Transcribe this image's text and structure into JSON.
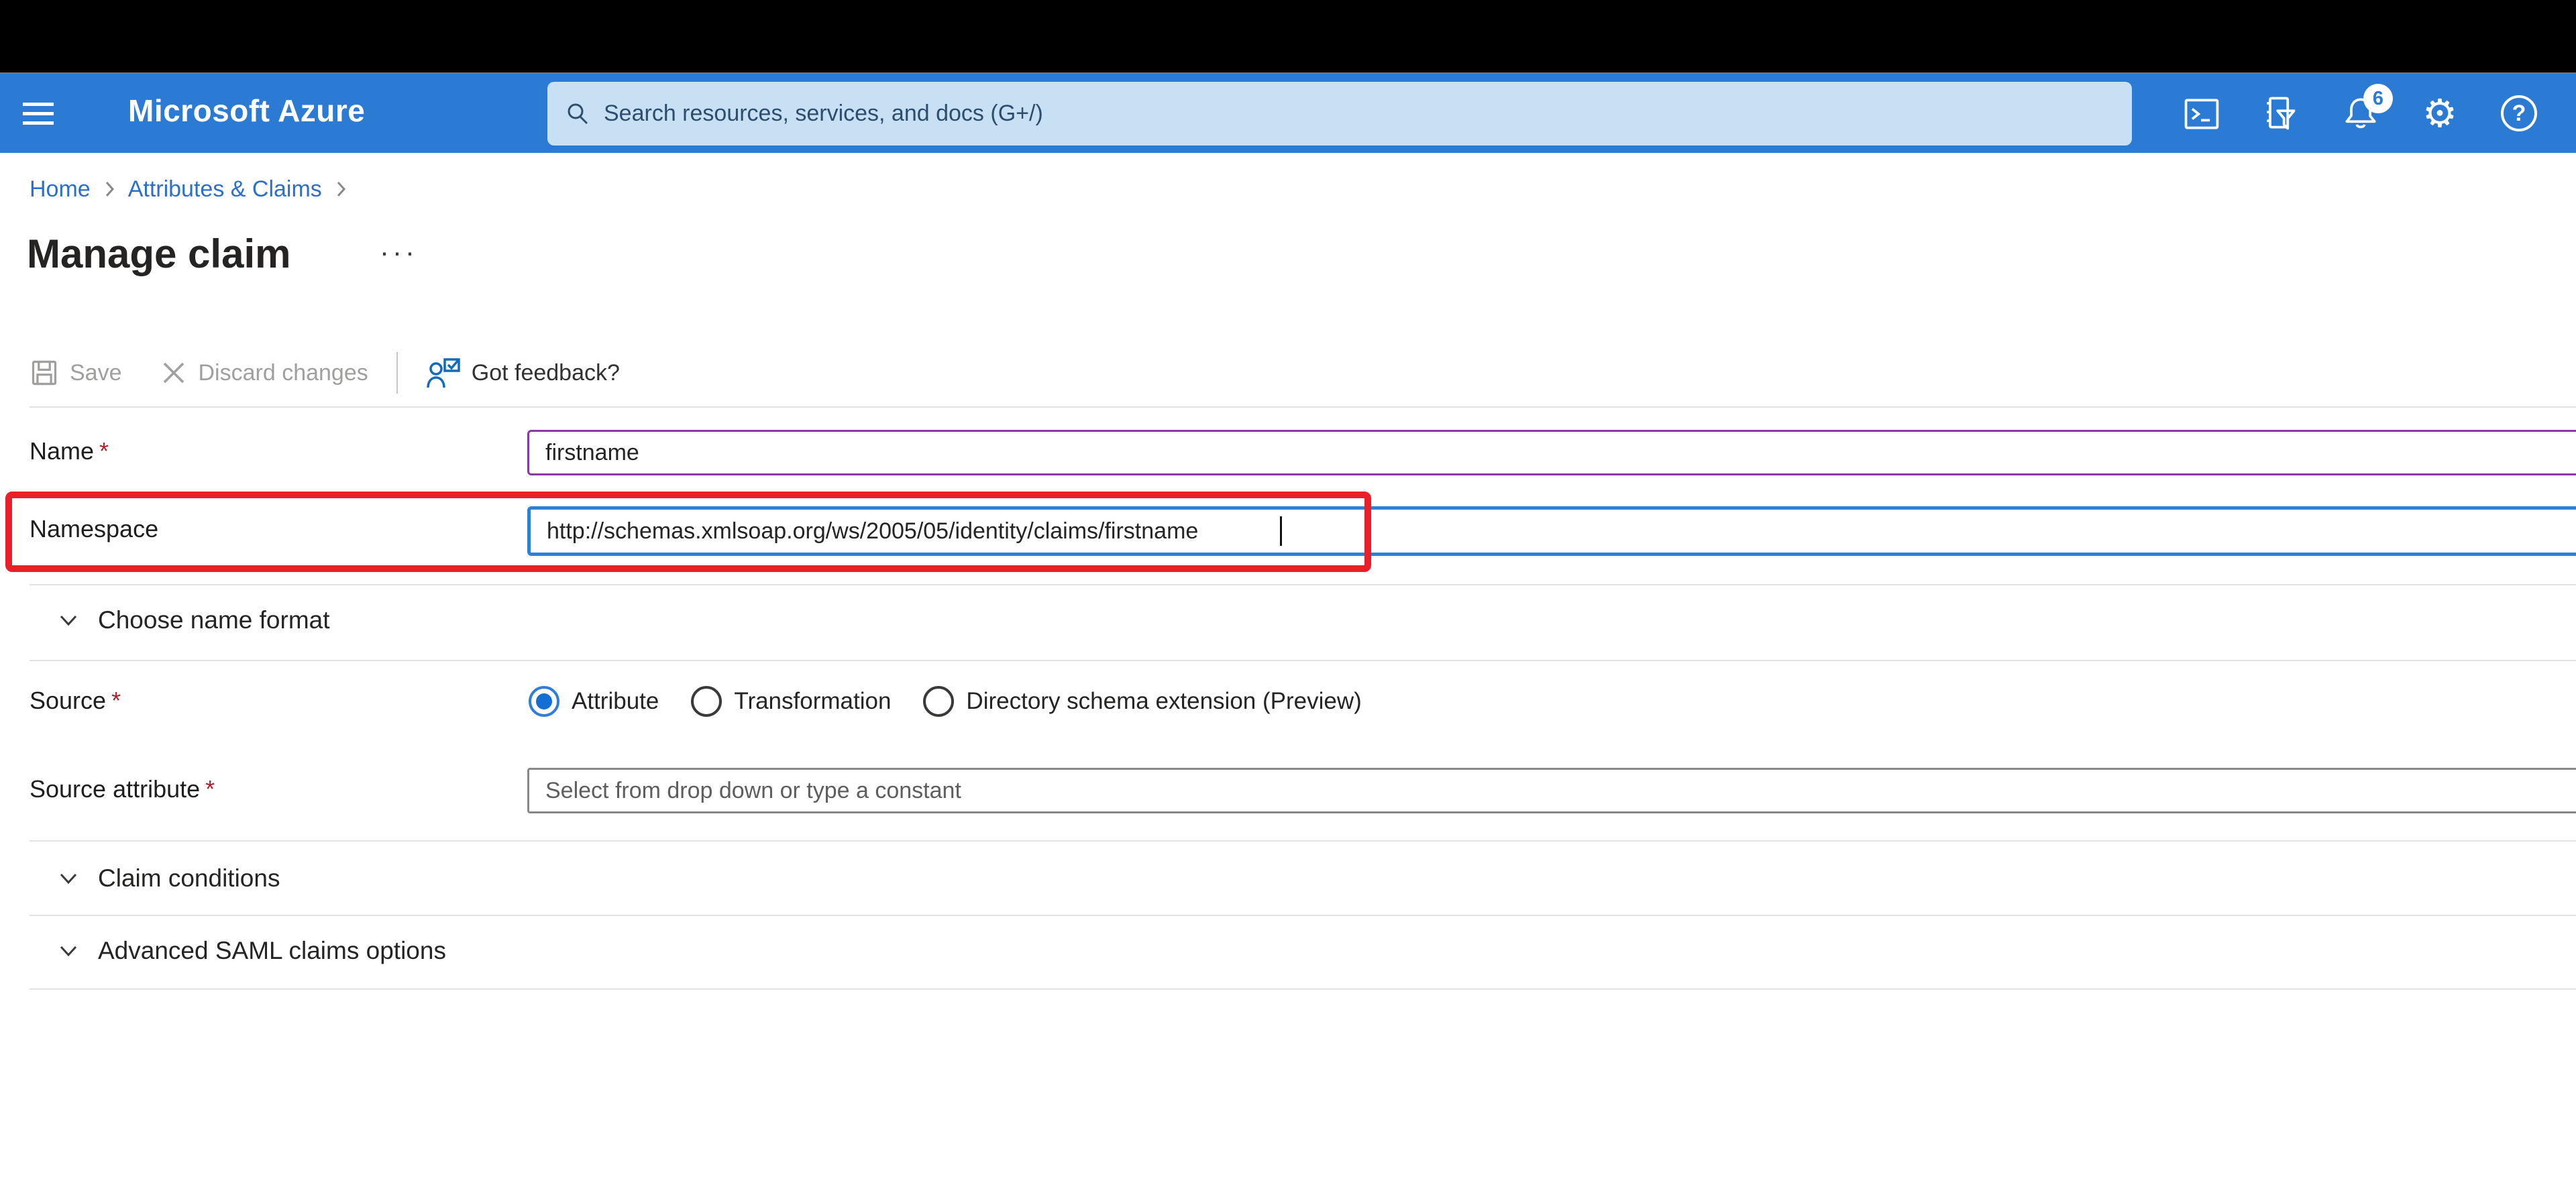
{
  "topbar": {
    "brand": "Microsoft Azure",
    "search_placeholder": "Search resources, services, and docs (G+/)",
    "notification_count": "6",
    "help_glyph": "?",
    "gear_glyph": "⚙"
  },
  "breadcrumb": {
    "home": "Home",
    "claims": "Attributes & Claims"
  },
  "page": {
    "title": "Manage claim",
    "more_label": "···"
  },
  "toolbar": {
    "save_label": "Save",
    "discard_label": "Discard changes",
    "feedback_label": "Got feedback?"
  },
  "form": {
    "name": {
      "label": "Name",
      "required": "*",
      "value": "firstname"
    },
    "namespace": {
      "label": "Namespace",
      "value": "http://schemas.xmlsoap.org/ws/2005/05/identity/claims/firstname"
    },
    "choose_name_format": {
      "label": "Choose name format"
    },
    "source": {
      "label": "Source",
      "required": "*",
      "options": [
        {
          "label": "Attribute",
          "selected": true
        },
        {
          "label": "Transformation",
          "selected": false
        },
        {
          "label": "Directory schema extension (Preview)",
          "selected": false
        }
      ]
    },
    "source_attribute": {
      "label": "Source attribute",
      "required": "*",
      "placeholder": "Select from drop down or type a constant"
    },
    "claim_conditions": {
      "label": "Claim conditions"
    },
    "advanced_saml": {
      "label": "Advanced SAML claims options"
    }
  },
  "colors": {
    "topbar_blue": "#2b7ad4",
    "search_bg": "#c7e0f4",
    "link_blue": "#2a6fd0",
    "focus_border_blue": "#2e81d8",
    "modified_border_purple": "#8b3aa5",
    "annotation_red": "#e9202a",
    "disabled_gray": "#a19f9d",
    "required_red": "#a4262c"
  }
}
